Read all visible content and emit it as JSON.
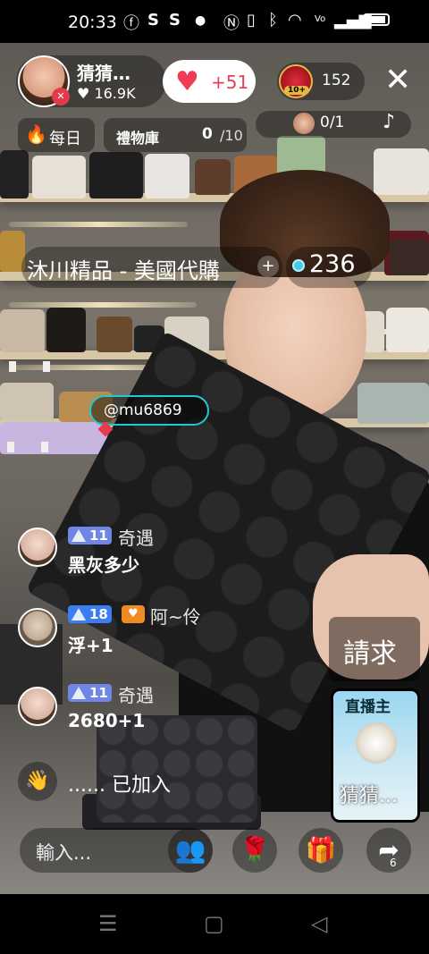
{
  "status_bar": {
    "time": "20:33",
    "app_icons": [
      "facebook-icon",
      "s-icon",
      "s-icon",
      "dot-icon"
    ],
    "system_icons": [
      "nfc-icon",
      "vibrate-icon",
      "bluetooth-icon",
      "wifi-icon",
      "volte-icon",
      "signal-icon",
      "battery-icon"
    ],
    "s1": "S",
    "s2": "S"
  },
  "host": {
    "name": "猜猜…",
    "likes": "16.9K",
    "like_prefix": "♥"
  },
  "follow": {
    "count": "+51"
  },
  "viewers": {
    "badge": "10+",
    "count": "152"
  },
  "daily": {
    "label": "每日"
  },
  "gift_library": {
    "label": "禮物庫",
    "count": "0",
    "total": "/10"
  },
  "rank": {
    "count": "0/1"
  },
  "shop": {
    "name": "沐川精品 - 美國代購",
    "plus": "+",
    "gem_count": "236"
  },
  "mention": {
    "text": "@mu6869"
  },
  "chat": [
    {
      "level": "11",
      "user": "奇遇",
      "message": "黑灰多少",
      "badge_color": "#6f86e6"
    },
    {
      "level": "18",
      "user": "阿~伶",
      "message": "浮+1",
      "badge_color": "#3b7ef2"
    },
    {
      "level": "11",
      "user": "奇遇",
      "message": "2680+1",
      "badge_color": "#6f86e6"
    }
  ],
  "joined": {
    "text": "...... 已加入"
  },
  "request": {
    "label": "請求"
  },
  "host_card": {
    "tag": "直播主",
    "name": "猜猜..."
  },
  "input": {
    "placeholder": "輸入..."
  },
  "share": {
    "count": "6"
  },
  "colors": {
    "accent_heart": "#ef3c56",
    "mention_border": "#1ecbd1",
    "gem": "#49c7e8"
  }
}
